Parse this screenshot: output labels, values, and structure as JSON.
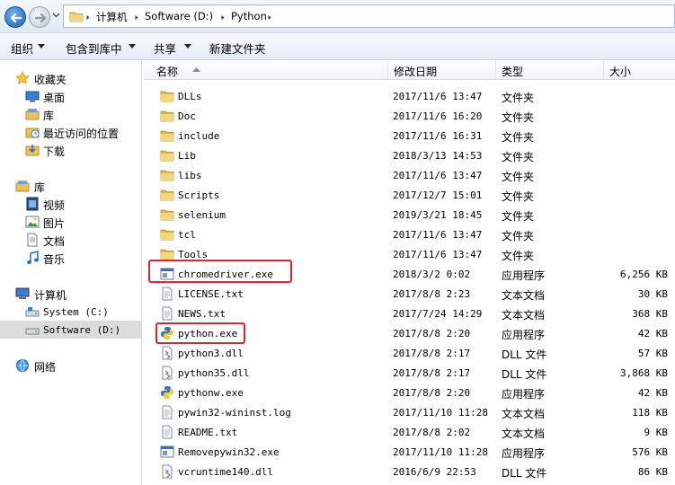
{
  "address": {
    "crumbs": [
      "计算机",
      "Software (D:)",
      "Python"
    ]
  },
  "toolbar": {
    "organize": "组织",
    "include_in_library": "包含到库中",
    "share": "共享",
    "new_folder": "新建文件夹"
  },
  "nav": {
    "favorites": "收藏夹",
    "desktop": "桌面",
    "library_fav": "库",
    "recent": "最近访问的位置",
    "downloads": "下载",
    "libraries": "库",
    "videos": "视频",
    "pictures": "图片",
    "documents": "文档",
    "music": "音乐",
    "computer": "计算机",
    "system_drive": "System (C:)",
    "software_drive": "Software (D:)",
    "network": "网络"
  },
  "columns": {
    "name": "名称",
    "modified": "修改日期",
    "type": "类型",
    "size": "大小"
  },
  "files": [
    {
      "name": "DLLs",
      "date": "2017/11/6 13:47",
      "type": "文件夹",
      "size": "",
      "icon": "folder-icon"
    },
    {
      "name": "Doc",
      "date": "2017/11/6 16:20",
      "type": "文件夹",
      "size": "",
      "icon": "folder-icon"
    },
    {
      "name": "include",
      "date": "2017/11/6 16:31",
      "type": "文件夹",
      "size": "",
      "icon": "folder-icon"
    },
    {
      "name": "Lib",
      "date": "2018/3/13 14:53",
      "type": "文件夹",
      "size": "",
      "icon": "folder-icon"
    },
    {
      "name": "libs",
      "date": "2017/11/6 13:47",
      "type": "文件夹",
      "size": "",
      "icon": "folder-icon"
    },
    {
      "name": "Scripts",
      "date": "2017/12/7 15:01",
      "type": "文件夹",
      "size": "",
      "icon": "folder-icon"
    },
    {
      "name": "selenium",
      "date": "2019/3/21 18:45",
      "type": "文件夹",
      "size": "",
      "icon": "folder-icon"
    },
    {
      "name": "tcl",
      "date": "2017/11/6 13:47",
      "type": "文件夹",
      "size": "",
      "icon": "folder-icon"
    },
    {
      "name": "Tools",
      "date": "2017/11/6 13:47",
      "type": "文件夹",
      "size": "",
      "icon": "folder-icon"
    },
    {
      "name": "chromedriver.exe",
      "date": "2018/3/2 0:02",
      "type": "应用程序",
      "size": "6,256 KB",
      "icon": "exe-icon"
    },
    {
      "name": "LICENSE.txt",
      "date": "2017/8/8 2:23",
      "type": "文本文档",
      "size": "30 KB",
      "icon": "text-file-icon"
    },
    {
      "name": "NEWS.txt",
      "date": "2017/7/24 14:29",
      "type": "文本文档",
      "size": "368 KB",
      "icon": "text-file-icon"
    },
    {
      "name": "python.exe",
      "date": "2017/8/8 2:20",
      "type": "应用程序",
      "size": "42 KB",
      "icon": "python-icon"
    },
    {
      "name": "python3.dll",
      "date": "2017/8/8 2:17",
      "type": "DLL 文件",
      "size": "57 KB",
      "icon": "dll-icon"
    },
    {
      "name": "python35.dll",
      "date": "2017/8/8 2:17",
      "type": "DLL 文件",
      "size": "3,868 KB",
      "icon": "dll-icon"
    },
    {
      "name": "pythonw.exe",
      "date": "2017/8/8 2:20",
      "type": "应用程序",
      "size": "42 KB",
      "icon": "python-icon"
    },
    {
      "name": "pywin32-wininst.log",
      "date": "2017/11/10 11:28",
      "type": "文本文档",
      "size": "118 KB",
      "icon": "text-file-icon"
    },
    {
      "name": "README.txt",
      "date": "2017/8/8 2:02",
      "type": "文本文档",
      "size": "9 KB",
      "icon": "text-file-icon"
    },
    {
      "name": "Removepywin32.exe",
      "date": "2017/11/10 11:28",
      "type": "应用程序",
      "size": "576 KB",
      "icon": "exe-icon"
    },
    {
      "name": "vcruntime140.dll",
      "date": "2016/6/9 22:53",
      "type": "DLL 文件",
      "size": "86 KB",
      "icon": "dll-icon"
    }
  ],
  "colors": {
    "highlight": "#e0242b",
    "folder": "#e8c15a",
    "selected_nav": "#dcdcdc"
  }
}
